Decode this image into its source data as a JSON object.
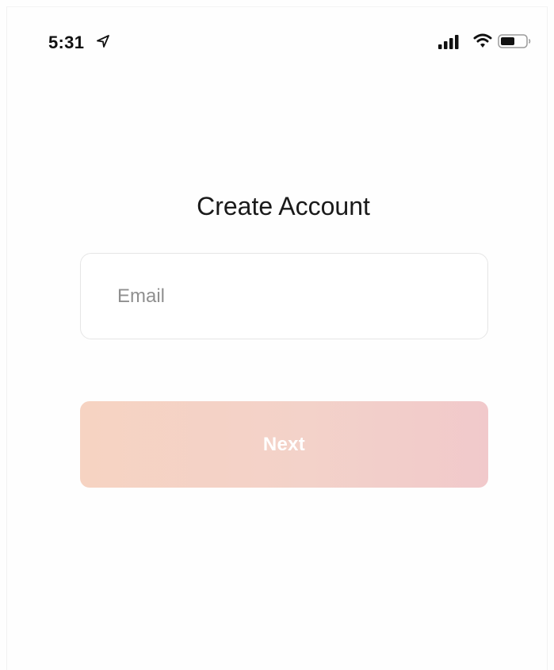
{
  "status_bar": {
    "time": "5:31",
    "icons": [
      "location-arrow-icon",
      "cellular-signal-icon",
      "wifi-icon",
      "battery-icon"
    ]
  },
  "screen": {
    "title": "Create Account",
    "email": {
      "value": "",
      "placeholder": "Email"
    },
    "next_button": {
      "label": "Next"
    }
  },
  "colors": {
    "text": "#1a1a1a",
    "placeholder": "#8f8f8f",
    "field_border": "#e6e6e6",
    "button_gradient_start": "#f6d3c2",
    "button_gradient_end": "#f1c9cb",
    "button_text": "#ffffff"
  }
}
